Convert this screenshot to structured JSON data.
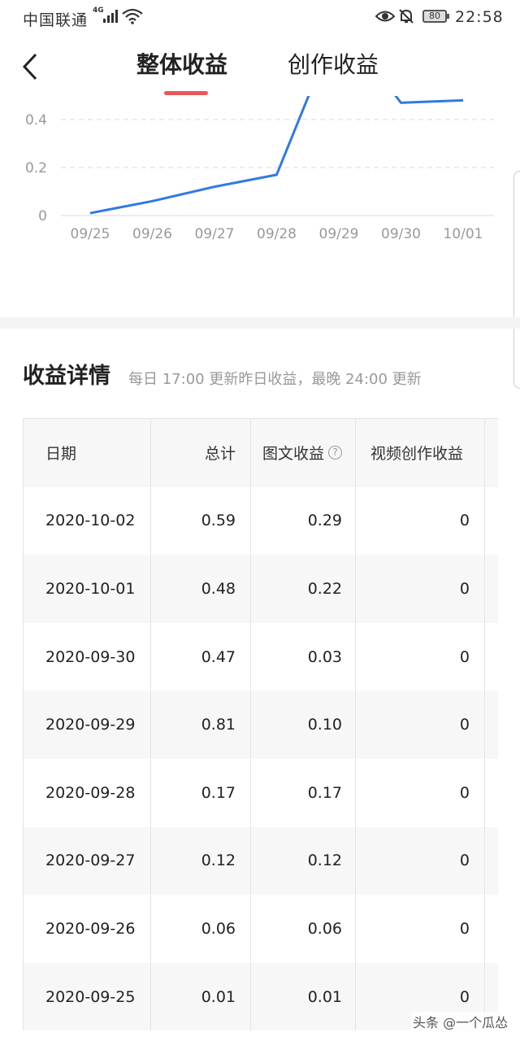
{
  "status_bar": {
    "carrier": "中国联通",
    "network": "4G",
    "battery": "80",
    "time": "22:58"
  },
  "header": {
    "back_icon": "chevron-left-icon",
    "tabs": [
      {
        "label": "整体收益",
        "active": true
      },
      {
        "label": "创作收益",
        "active": false
      }
    ],
    "accent_color": "#e8585a"
  },
  "chart_data": {
    "type": "line",
    "categories": [
      "09/25",
      "09/26",
      "09/27",
      "09/28",
      "09/29",
      "09/30",
      "10/01"
    ],
    "values": [
      0.01,
      0.06,
      0.12,
      0.17,
      0.81,
      0.47,
      0.48
    ],
    "y_ticks": [
      "0",
      "0.2",
      "0.4"
    ],
    "ylim": [
      0,
      0.5
    ],
    "grid": true,
    "line_color": "#2f7ae5"
  },
  "details": {
    "title": "收益详情",
    "subtitle": "每日 17:00 更新昨日收益，最晚 24:00 更新"
  },
  "table": {
    "headers": {
      "date": "日期",
      "total": "总计",
      "text": "图文收益",
      "video": "视频创作收益"
    },
    "rows": [
      {
        "date": "2020-10-02",
        "total": "0.59",
        "text": "0.29",
        "video": "0"
      },
      {
        "date": "2020-10-01",
        "total": "0.48",
        "text": "0.22",
        "video": "0"
      },
      {
        "date": "2020-09-30",
        "total": "0.47",
        "text": "0.03",
        "video": "0"
      },
      {
        "date": "2020-09-29",
        "total": "0.81",
        "text": "0.10",
        "video": "0"
      },
      {
        "date": "2020-09-28",
        "total": "0.17",
        "text": "0.17",
        "video": "0"
      },
      {
        "date": "2020-09-27",
        "total": "0.12",
        "text": "0.12",
        "video": "0"
      },
      {
        "date": "2020-09-26",
        "total": "0.06",
        "text": "0.06",
        "video": "0"
      },
      {
        "date": "2020-09-25",
        "total": "0.01",
        "text": "0.01",
        "video": "0"
      }
    ]
  },
  "watermark": "头条 @一个瓜怂"
}
